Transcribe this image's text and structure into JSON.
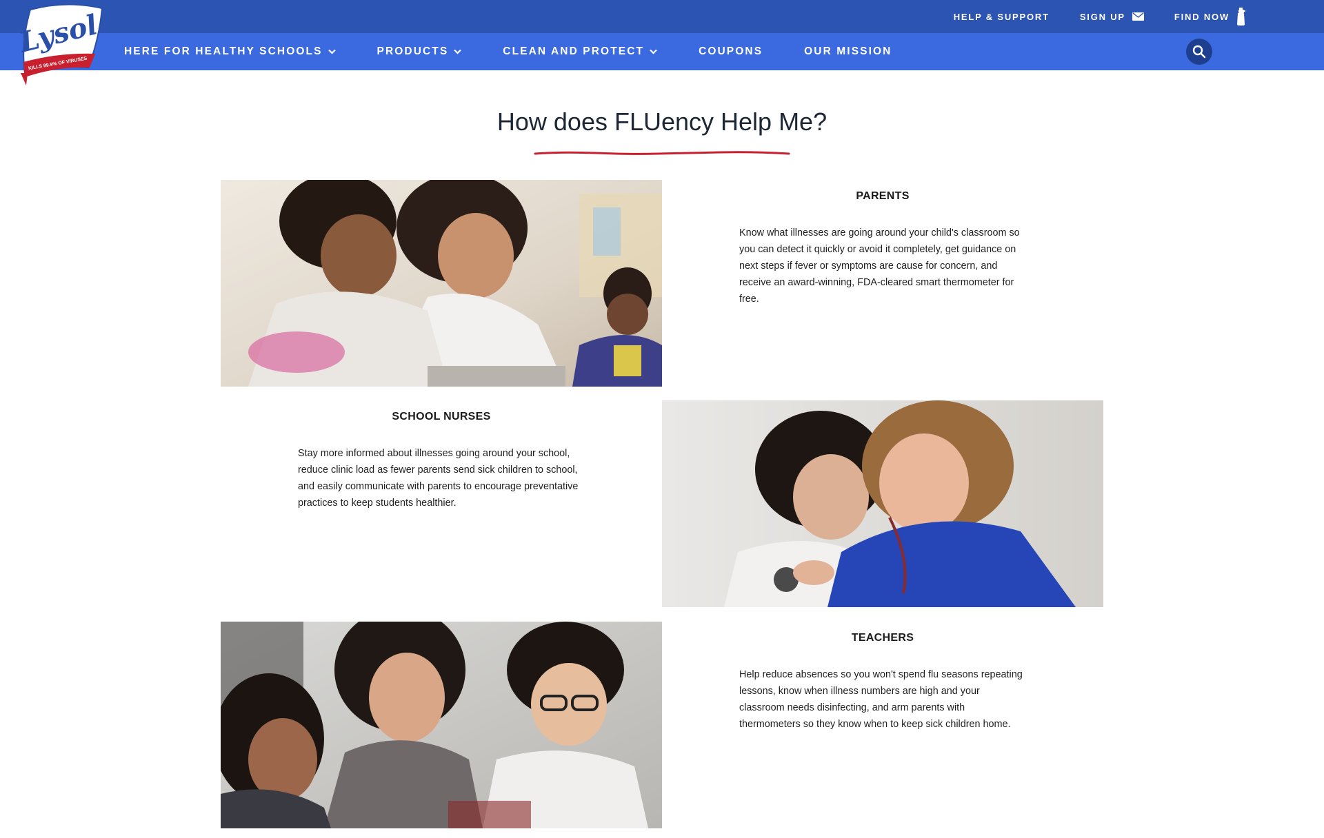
{
  "brand": {
    "logo_text": "Lysol",
    "logo_tagline": "KILLS 99.9% OF VIRUSES & BACTERIA",
    "accent_red": "#c8202f",
    "nav_blue": "#3b6ae0",
    "utility_blue": "#2c54b3"
  },
  "utility": {
    "help_support": "HELP & SUPPORT",
    "sign_up": "SIGN UP",
    "find_now": "FIND NOW"
  },
  "nav": {
    "items": [
      {
        "label": "HERE FOR HEALTHY SCHOOLS",
        "has_dropdown": true
      },
      {
        "label": "PRODUCTS",
        "has_dropdown": true
      },
      {
        "label": "CLEAN AND PROTECT",
        "has_dropdown": true
      },
      {
        "label": "COUPONS",
        "has_dropdown": false
      },
      {
        "label": "OUR MISSION",
        "has_dropdown": false
      }
    ],
    "search_icon": "search-icon"
  },
  "main": {
    "title": "How does FLUency Help Me?",
    "sections": [
      {
        "heading": "PARENTS",
        "text": "Know what illnesses are going around your child's classroom so you can detect it quickly or avoid it completely, get guidance on next steps if fever or symptoms are cause for concern, and receive an award-winning, FDA-cleared smart thermometer for free."
      },
      {
        "heading": "SCHOOL NURSES",
        "text": "Stay more informed about illnesses going around your school, reduce clinic load as fewer parents send sick children to school, and easily communicate with parents to encourage preventative practices to keep students healthier."
      },
      {
        "heading": "TEACHERS",
        "text": "Help reduce absences so you won't spend flu seasons repeating lessons, know when illness numbers are high and your classroom needs disinfecting, and arm parents with thermometers so they know when to keep sick children home."
      }
    ]
  }
}
